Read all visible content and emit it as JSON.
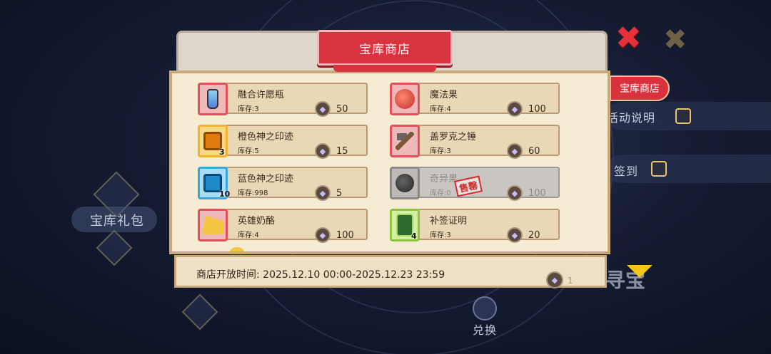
{
  "background": {
    "left_pack_label": "宝库礼包",
    "exchange_label": "兑换",
    "hunt_label": "寻宝",
    "side_menu": [
      {
        "label": "宝库商店"
      },
      {
        "label": "活动说明"
      },
      {
        "label": "签到"
      }
    ]
  },
  "shop": {
    "title": "宝库商店",
    "items": [
      {
        "name": "融合许愿瓶",
        "stock": "库存:3",
        "price": "50",
        "icon": "wish-bottle-icon",
        "frame": "red",
        "count": "",
        "sold_out": false
      },
      {
        "name": "魔法果",
        "stock": "库存:4",
        "price": "100",
        "icon": "magic-fruit-icon",
        "frame": "red",
        "count": "",
        "sold_out": false
      },
      {
        "name": "橙色神之印迹",
        "stock": "库存:5",
        "price": "15",
        "icon": "orange-god-seal-icon",
        "frame": "orange",
        "count": "3",
        "sold_out": false
      },
      {
        "name": "盖罗克之锤",
        "stock": "库存:3",
        "price": "60",
        "icon": "hammer-icon",
        "frame": "red",
        "count": "",
        "sold_out": false
      },
      {
        "name": "蓝色神之印迹",
        "stock": "库存:998",
        "price": "5",
        "icon": "blue-god-seal-icon",
        "frame": "blue",
        "count": "10",
        "sold_out": false
      },
      {
        "name": "奇异果",
        "stock": "库存:0",
        "price": "100",
        "icon": "dark-fruit-icon",
        "frame": "grey",
        "count": "",
        "sold_out": true,
        "sold_label": "售罄"
      },
      {
        "name": "英雄奶酪",
        "stock": "库存:4",
        "price": "100",
        "icon": "cheese-icon",
        "frame": "red",
        "count": "",
        "sold_out": false
      },
      {
        "name": "补签证明",
        "stock": "库存:3",
        "price": "20",
        "icon": "resign-card-icon",
        "frame": "green",
        "count": "4",
        "sold_out": false
      }
    ],
    "footer": {
      "time_label": "商店开放时间:  2025.12.10 00:00-2025.12.23 23:59",
      "balance": "1"
    }
  },
  "colors": {
    "accent_red": "#d7343f",
    "panel_cream": "#f6ecd4",
    "currency_purple": "#c7b9ff"
  }
}
